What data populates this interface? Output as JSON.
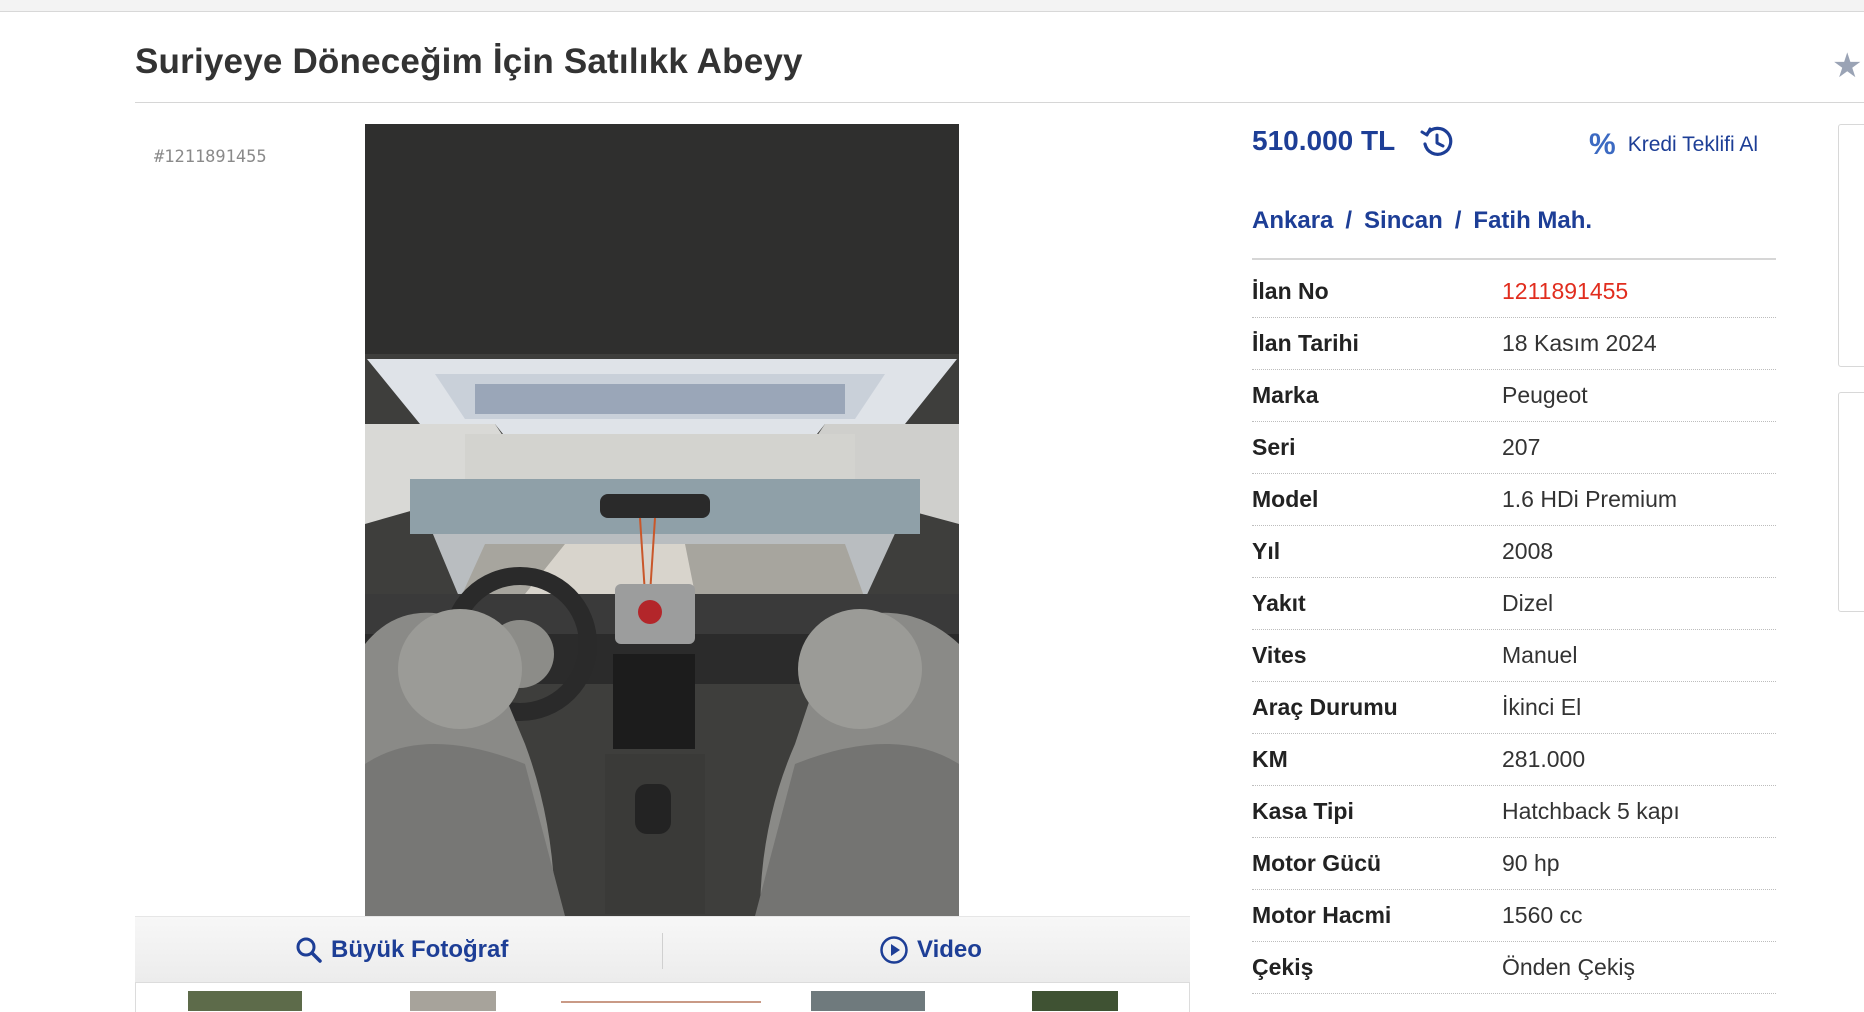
{
  "listing": {
    "title": "Suriyeye Döneceğim İçin Satılıkk Abeyy",
    "ad_number_tag": "#1211891455"
  },
  "photo_actions": {
    "large_photo_label": "Büyük Fotoğraf",
    "video_label": "Video"
  },
  "price": {
    "value": "510.000 TL",
    "history_icon": "price-history-icon"
  },
  "credit": {
    "icon": "%",
    "label": "Kredi Teklifi Al"
  },
  "location": {
    "city": "Ankara",
    "district": "Sincan",
    "neighborhood": "Fatih Mah.",
    "separator": "/"
  },
  "specs": [
    {
      "label": "İlan No",
      "value": "1211891455",
      "highlight": true
    },
    {
      "label": "İlan Tarihi",
      "value": "18 Kasım 2024"
    },
    {
      "label": "Marka",
      "value": "Peugeot"
    },
    {
      "label": "Seri",
      "value": "207"
    },
    {
      "label": "Model",
      "value": "1.6 HDi Premium"
    },
    {
      "label": "Yıl",
      "value": "2008"
    },
    {
      "label": "Yakıt",
      "value": "Dizel"
    },
    {
      "label": "Vites",
      "value": "Manuel"
    },
    {
      "label": "Araç Durumu",
      "value": "İkinci El"
    },
    {
      "label": "KM",
      "value": "281.000"
    },
    {
      "label": "Kasa Tipi",
      "value": "Hatchback 5 kapı"
    },
    {
      "label": "Motor Gücü",
      "value": "90 hp"
    },
    {
      "label": "Motor Hacmi",
      "value": "1560 cc"
    },
    {
      "label": "Çekiş",
      "value": "Önden Çekiş"
    }
  ],
  "colors": {
    "brand_blue": "#1d3e96",
    "ad_no_red": "#e12d1e"
  }
}
